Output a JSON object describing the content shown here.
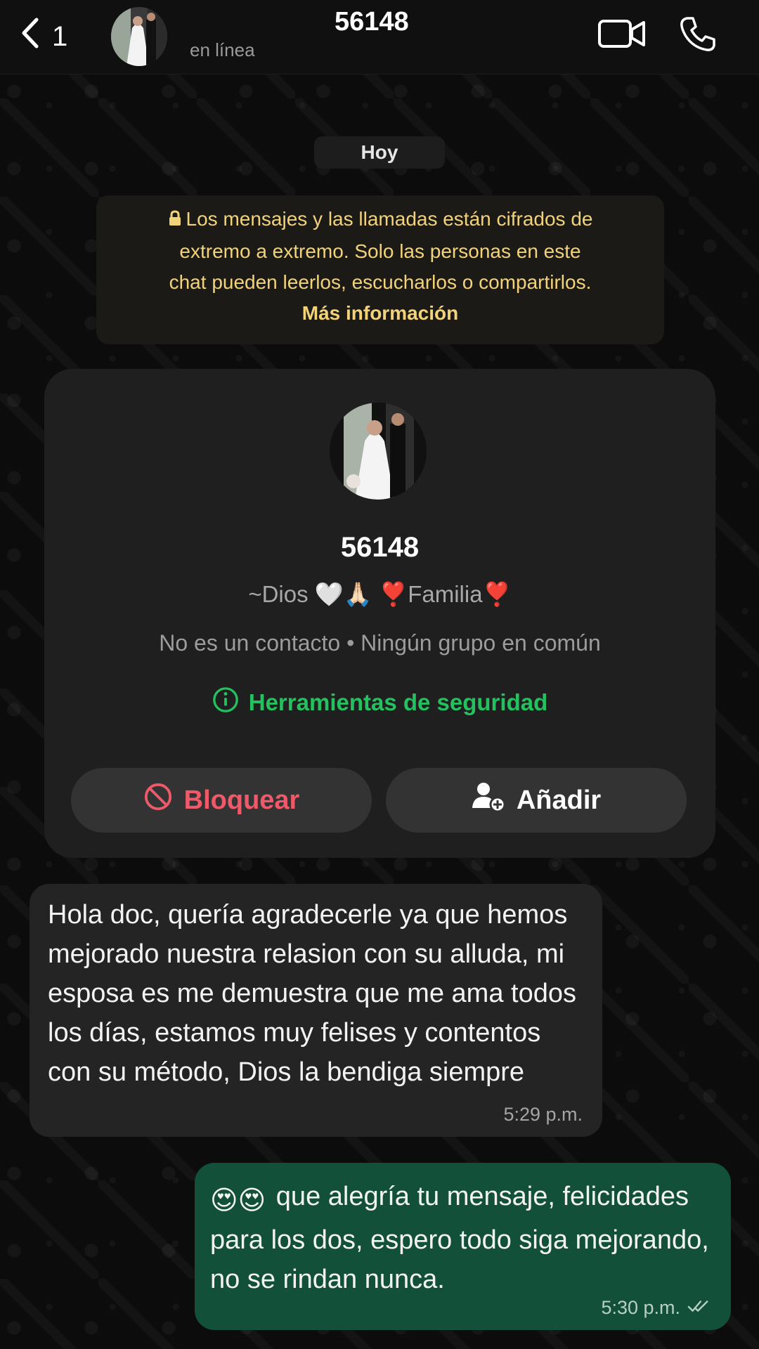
{
  "header": {
    "back_count": "1",
    "title": "56148",
    "status": "en línea",
    "icons": [
      "back-chevron-icon",
      "video-call-icon",
      "voice-call-icon"
    ]
  },
  "date_chip": "Hoy",
  "encryption_notice": {
    "line1": "Los mensajes y las llamadas están cifrados de",
    "line2": "extremo a extremo. Solo las personas en este",
    "line3": "chat pueden leerlos, escucharlos o compartirlos.",
    "more_link": "Más información"
  },
  "contact_card": {
    "name": "56148",
    "about": "~Dios 🤍🙏🏻 ❣️Familia❣️",
    "meta": "No es un contacto • Ningún grupo en común",
    "security_tools": "Herramientas de seguridad",
    "block_label": "Bloquear",
    "add_label": "Añadir"
  },
  "messages": [
    {
      "direction": "incoming",
      "text": "Hola doc, quería agradecerle ya que hemos mejorado nuestra relasion con su alluda, mi esposa es me demuestra que me ama todos los días, estamos muy felises y contentos con su método, Dios la bendiga siempre",
      "time": "5:29 p.m."
    },
    {
      "direction": "outgoing",
      "emoji_prefix": "😍😍",
      "text": "que alegría tu mensaje, felicidades para los dos, espero todo siga mejorando, no se rindan nunca.",
      "time": "5:30 p.m.",
      "status": "read"
    }
  ],
  "colors": {
    "accent_green": "#25c05f",
    "block_red": "#ef5a6a",
    "notice_yellow": "#f2d37a",
    "outgoing_bubble": "#12503a",
    "incoming_bubble": "#242424"
  }
}
